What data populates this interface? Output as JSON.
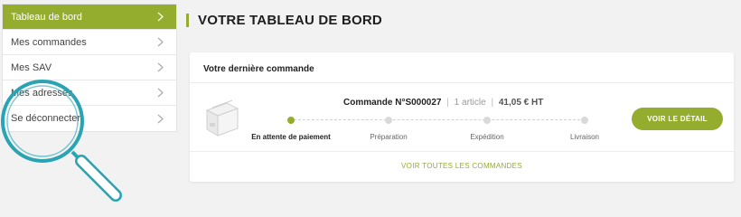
{
  "sidebar": {
    "items": [
      {
        "label": "Tableau de bord",
        "active": true
      },
      {
        "label": "Mes commandes"
      },
      {
        "label": "Mes SAV"
      },
      {
        "label": "Mes adresses"
      },
      {
        "label": "Se déconnecter"
      }
    ]
  },
  "header": {
    "title": "VOTRE TABLEAU DE BORD"
  },
  "last_order": {
    "title": "Votre dernière commande",
    "order_number": "Commande N°S000027",
    "article_count": "1 article",
    "price": "41,05 € HT",
    "steps": [
      {
        "label": "En attente de paiement",
        "state": "current"
      },
      {
        "label": "Préparation",
        "state": "pending"
      },
      {
        "label": "Expédition",
        "state": "pending"
      },
      {
        "label": "Livraison",
        "state": "pending"
      }
    ],
    "detail_button": "VOIR LE DÉTAIL",
    "all_orders_link": "VOIR TOUTES LES COMMANDES"
  },
  "colors": {
    "accent": "#94ad2e",
    "magnifier": "#2aa3b3"
  },
  "icons": [
    "chevron-right-icon",
    "package-box-icon",
    "magnifier-icon"
  ]
}
